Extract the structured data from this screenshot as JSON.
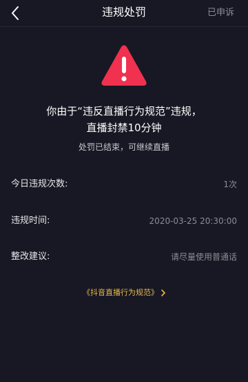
{
  "header": {
    "title": "违规处罚",
    "appeal_label": "已申诉"
  },
  "message": {
    "line1": "你由于“违反直播行为规范”违规，",
    "line2": "直播封禁10分钟",
    "sub": "处罚已结束，可继续直播"
  },
  "details": [
    {
      "label": "今日违规次数:",
      "value": "1次"
    },
    {
      "label": "违规时间:",
      "value": "2020-03-25 20:30:00"
    },
    {
      "label": "整改建议:",
      "value": "请尽量使用普通话"
    }
  ],
  "rules_link": "《抖音直播行为规范》",
  "icons": {
    "back": "chevron-left-icon",
    "warning": "warning-triangle-icon",
    "link": "chevron-right-icon"
  },
  "colors": {
    "background": "#171823",
    "warning": "#f0314f",
    "link": "#e8b84c",
    "muted": "#8b8c94"
  }
}
